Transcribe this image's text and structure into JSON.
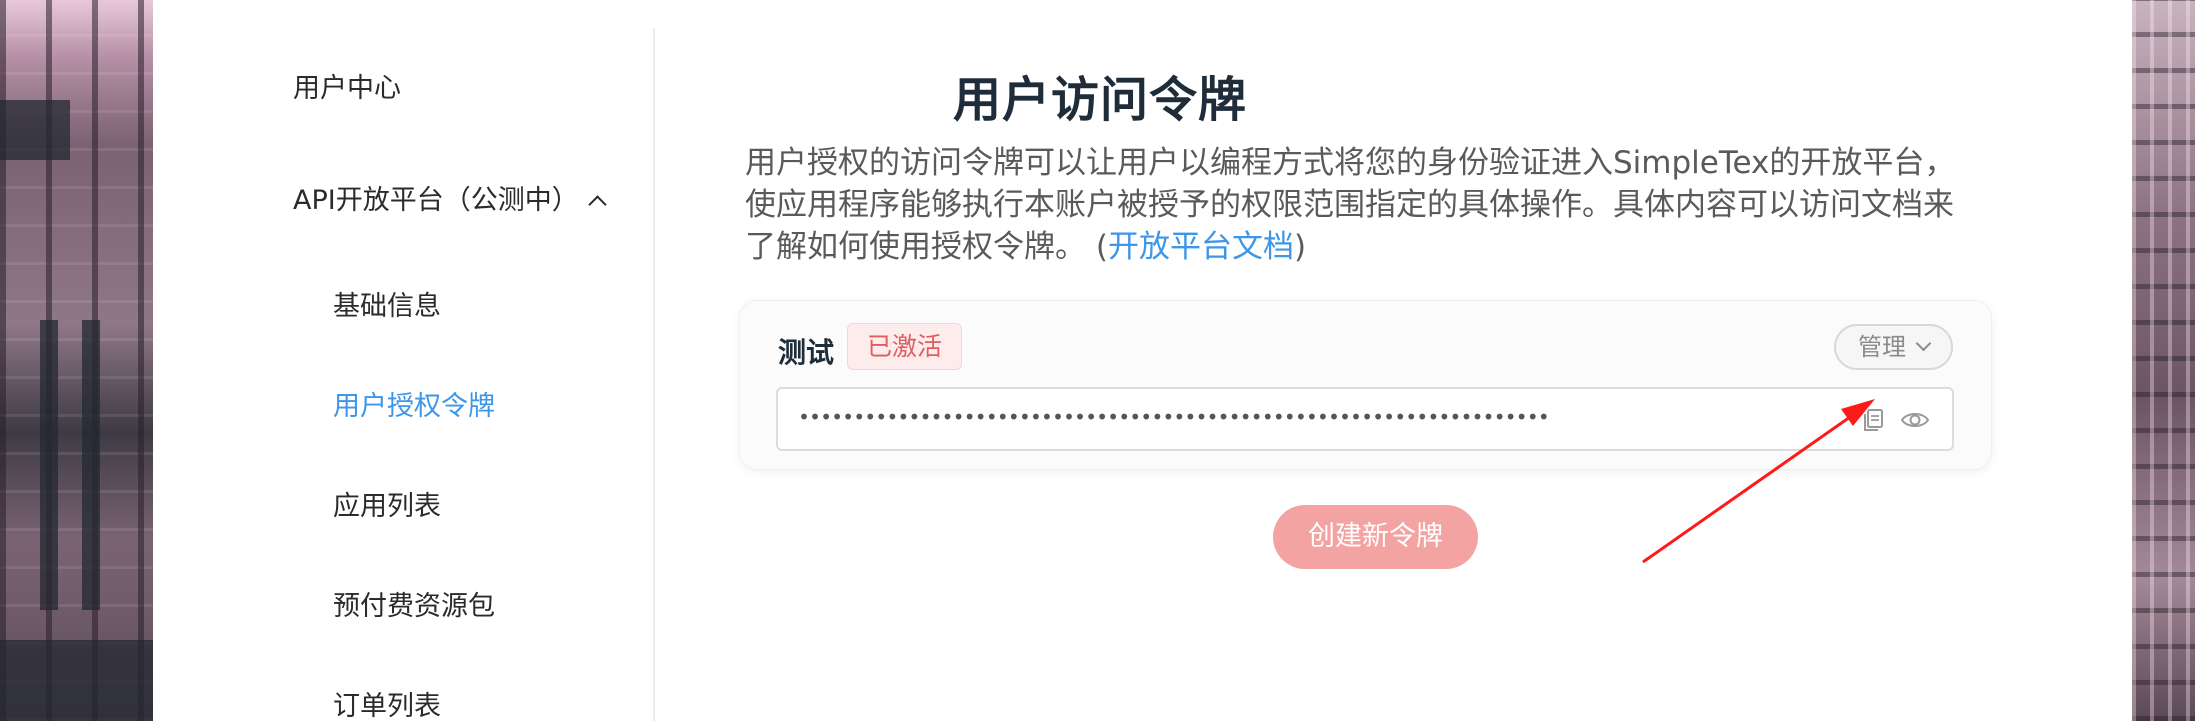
{
  "sidebar": {
    "items": [
      {
        "label": "用户中心"
      },
      {
        "label": "API开放平台（公测中）"
      },
      {
        "label": "基础信息"
      },
      {
        "label": "用户授权令牌"
      },
      {
        "label": "应用列表"
      },
      {
        "label": "预付费资源包"
      },
      {
        "label": "订单列表"
      }
    ],
    "active_item": "用户授权令牌"
  },
  "main": {
    "title": "用户访问令牌",
    "description_line1": "用户授权的访问令牌可以让用户以编程方式将您的身份验证进入SimpleTex的开放平台，",
    "description_line2": "使应用程序能够执行本账户被授予的权限范围指定的具体操作。具体内容可以访问文档来",
    "description_line3_prefix": "了解如何使用授权令牌。 (",
    "description_link": "开放平台文档",
    "description_line3_suffix": ")"
  },
  "token_card": {
    "name": "测试",
    "status": "已激活",
    "manage_label": "管理",
    "token_masked": "••••••••••••••••••••••••••••••••••••••••••••••••••••••••••••••••••••",
    "icons": [
      "copy-icon",
      "eye-icon"
    ]
  },
  "actions": {
    "create_label": "创建新令牌"
  },
  "colors": {
    "accent": "#3d96e8",
    "status_red": "#e05d5d",
    "create_button": "#f4a3a3",
    "annotation_arrow": "#ff1a1a"
  }
}
